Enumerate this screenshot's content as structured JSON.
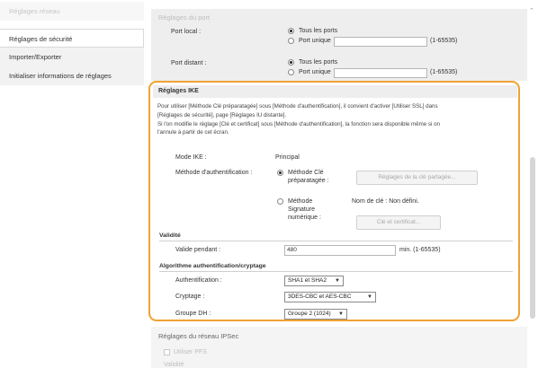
{
  "sidebar": {
    "items": [
      {
        "label": "Réglages réseau"
      },
      {
        "label": "Réglages de sécurité"
      },
      {
        "label": "Importer/Exporter"
      },
      {
        "label": "Initialiser informations de réglages"
      }
    ]
  },
  "port_settings": {
    "heading": "Réglages du port",
    "local_port": {
      "label": "Port local :",
      "option_all": "Tous les ports",
      "option_single": "Port unique",
      "value": "",
      "range": "(1-65535)"
    },
    "remote_port": {
      "label": "Port distant :",
      "option_all": "Tous les ports",
      "option_single": "Port unique",
      "value": "",
      "range": "(1-65535)"
    }
  },
  "ike": {
    "heading": "Réglages IKE",
    "description_1": "Pour utiliser [Méthode Clé préparatagée] sous [Méthode d'authentification], il convient d'activer [Utiliser SSL] dans",
    "description_2": "[Réglages de sécurité], page [Réglages IU distante].",
    "description_3": "Si l'on modifie le réglage [Clé et certificat] sous [Méthode d'authentification], la fonction sera disponible même si on",
    "description_4": "l'annule à partir de cet écran.",
    "mode_label": "Mode IKE :",
    "mode_value": "Principal",
    "auth_method_label": "Méthode d'authentification :",
    "psk_option_1": "Méthode Clé",
    "psk_option_2": "préparatagée :",
    "psk_button": "Réglages de la clé partagée...",
    "sig_option_1": "Méthode",
    "sig_option_2": "Signature",
    "sig_option_3": "numérique :",
    "key_name": "Nom de clé : Non défini.",
    "cert_button": "Clé et certificat..."
  },
  "validity": {
    "heading": "Validité",
    "label": "Valide pendant :",
    "value": "480",
    "range": "min. (1-65535)"
  },
  "algorithm": {
    "heading": "Algorithme authentification/cryptage",
    "auth_label": "Authentification :",
    "auth_value": "SHA1 et SHA2",
    "crypto_label": "Cryptage :",
    "crypto_value": "3DES-CBC et AES-CBC",
    "dh_label": "Groupe DH :",
    "dh_value": "Groupe 2 (1024)"
  },
  "ipsec": {
    "heading": "Réglages du réseau IPSec",
    "pfs_label": "Utiliser PFS",
    "validity_label": "Validité"
  }
}
